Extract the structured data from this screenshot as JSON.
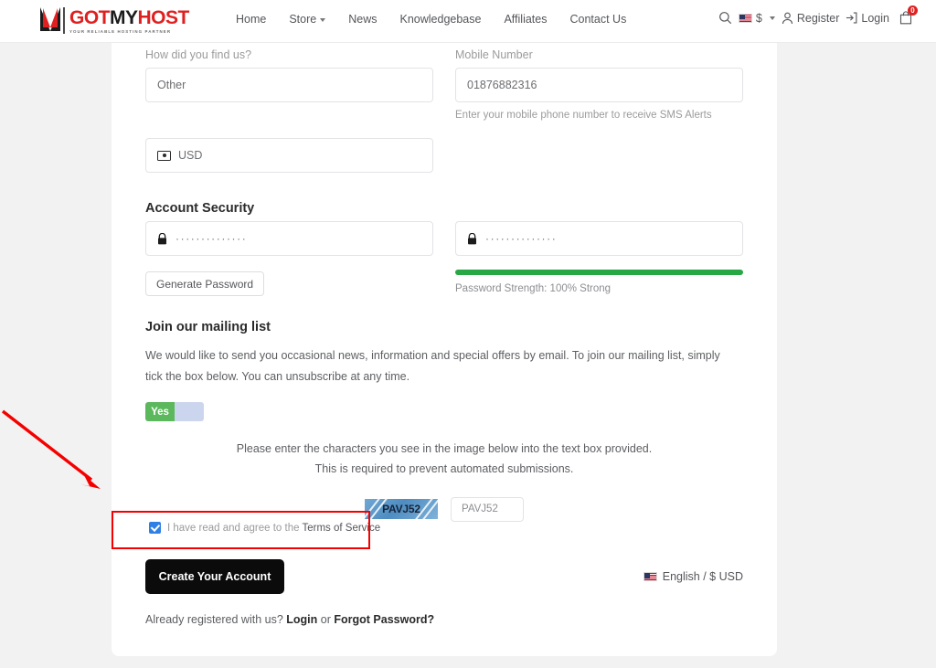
{
  "header": {
    "logo": {
      "part1": "GOT",
      "part2": "MY",
      "part3": "HOST",
      "tagline": "YOUR RELIABLE HOSTING PARTNER"
    },
    "nav": [
      {
        "label": "Home",
        "has_dropdown": false
      },
      {
        "label": "Store",
        "has_dropdown": true
      },
      {
        "label": "News",
        "has_dropdown": false
      },
      {
        "label": "Knowledgebase",
        "has_dropdown": false
      },
      {
        "label": "Affiliates",
        "has_dropdown": false
      },
      {
        "label": "Contact Us",
        "has_dropdown": false
      }
    ],
    "user": {
      "currency": "$",
      "register_label": "Register",
      "login_label": "Login",
      "cart_count": "0"
    }
  },
  "form": {
    "find_us": {
      "label": "How did you find us?",
      "value": "Other"
    },
    "mobile": {
      "label": "Mobile Number",
      "value": "01876882316",
      "help": "Enter your mobile phone number to receive SMS Alerts"
    },
    "currency_field": {
      "value": "USD"
    },
    "security": {
      "title": "Account Security",
      "password_value": "··············",
      "confirm_value": "··············",
      "generate_label": "Generate Password",
      "strength_text": "Password Strength: 100% Strong",
      "strength_percent": 100,
      "strength_color": "#28a745"
    },
    "mailing": {
      "title": "Join our mailing list",
      "body": "We would like to send you occasional news, information and special offers by email. To join our mailing list, simply tick the box below. You can unsubscribe at any time.",
      "toggle_label": "Yes",
      "toggle_on": true,
      "toggle_on_color": "#5cb85c",
      "toggle_track_color": "#ccd5ee"
    },
    "captcha": {
      "instruction_line1": "Please enter the characters you see in the image below into the text box provided.",
      "instruction_line2": "This is required to prevent automated submissions.",
      "image_text": "PAVJ52",
      "input_value": "PAVJ52"
    },
    "terms": {
      "checked": true,
      "prefix": "I have read and agree to the",
      "link_label": "Terms of Service"
    },
    "submit_label": "Create Your Account",
    "language_picker": "English / $ USD",
    "footer": {
      "prefix": "Already registered with us?",
      "login_label": "Login",
      "separator": "or",
      "forgot_label": "Forgot Password?"
    }
  },
  "annotations": {
    "highlight_color": "#f50000",
    "arrow_color": "#f50000"
  }
}
